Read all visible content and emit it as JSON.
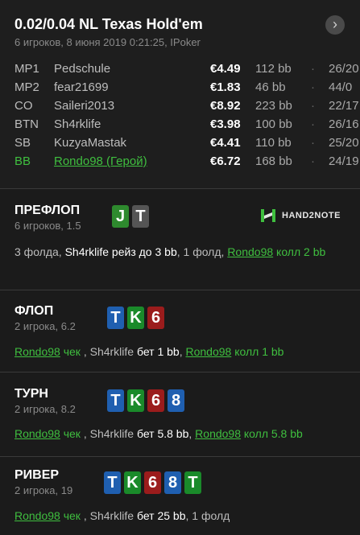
{
  "header": {
    "title": "0.02/0.04 NL Texas Hold'em",
    "subtitle": "6 игроков, 8 июня 2019 0:21:25, IPoker",
    "menu_icon": "chevron-right-icon",
    "menu_glyph": "›"
  },
  "players": [
    {
      "pos": "MP1",
      "name": "Pedschule",
      "stack": "€4.49",
      "bb": "112 bb",
      "sep": "·",
      "cards": "26/20"
    },
    {
      "pos": "MP2",
      "name": "fear21699",
      "stack": "€1.83",
      "bb": "46 bb",
      "sep": "·",
      "cards": "44/0"
    },
    {
      "pos": "CO",
      "name": "Saileri2013",
      "stack": "€8.92",
      "bb": "223 bb",
      "sep": "·",
      "cards": "22/17"
    },
    {
      "pos": "BTN",
      "name": "Sh4rklife",
      "stack": "€3.98",
      "bb": "100 bb",
      "sep": "·",
      "cards": "26/16"
    },
    {
      "pos": "SB",
      "name": "KuzyaMastak",
      "stack": "€4.41",
      "bb": "110 bb",
      "sep": "·",
      "cards": "25/20"
    },
    {
      "pos": "BB",
      "name": "Rondo98 (Герой)",
      "stack": "€6.72",
      "bb": "168 bb",
      "sep": "·",
      "cards": "24/19"
    }
  ],
  "colors": {
    "green": "#3fbf3f",
    "spade": "#2a2a2a",
    "heart": "#9b1c1c",
    "diamond": "#1f5fb0",
    "club": "#1a8a2a",
    "hand_j": "#2e8a2e",
    "hand_t": "#555555"
  },
  "logo": {
    "text": "HAND2NOTE"
  },
  "preflop": {
    "title": "ПРЕФЛОП",
    "sub": "6 игроков, 1.5",
    "hero_cards": [
      "J",
      "T"
    ],
    "action": {
      "p1": "3 фолда, ",
      "p2": "Sh4rklife",
      "p3": " рейз до 3 bb",
      "p4": ", 1 фолд, ",
      "p5": "Rondo98",
      "p6": " колл 2 bb"
    }
  },
  "flop": {
    "title": "ФЛОП",
    "sub": "2 игрока, 6.2",
    "board": [
      "T",
      "K",
      "6"
    ],
    "action": {
      "p1": "Rondo98",
      "p2": " чек",
      "p3": " , Sh4rklife",
      "p4": " бет 1 bb",
      "p5": ", ",
      "p6": "Rondo98",
      "p7": " колл 1 bb"
    }
  },
  "turn": {
    "title": "ТУРН",
    "sub": "2 игрока, 8.2",
    "board": [
      "T",
      "K",
      "6",
      "8"
    ],
    "action": {
      "p1": "Rondo98",
      "p2": " чек",
      "p3": " , Sh4rklife",
      "p4": " бет 5.8 bb",
      "p5": ", ",
      "p6": "Rondo98",
      "p7": " колл 5.8 bb"
    }
  },
  "river": {
    "title": "РИВЕР",
    "sub": "2 игрока, 19",
    "board": [
      "T",
      "K",
      "6",
      "8",
      "T"
    ],
    "action": {
      "p1": "Rondo98",
      "p2": " чек",
      "p3": " , Sh4rklife",
      "p4": " бет 25 bb",
      "p5": ", 1 фолд"
    }
  }
}
